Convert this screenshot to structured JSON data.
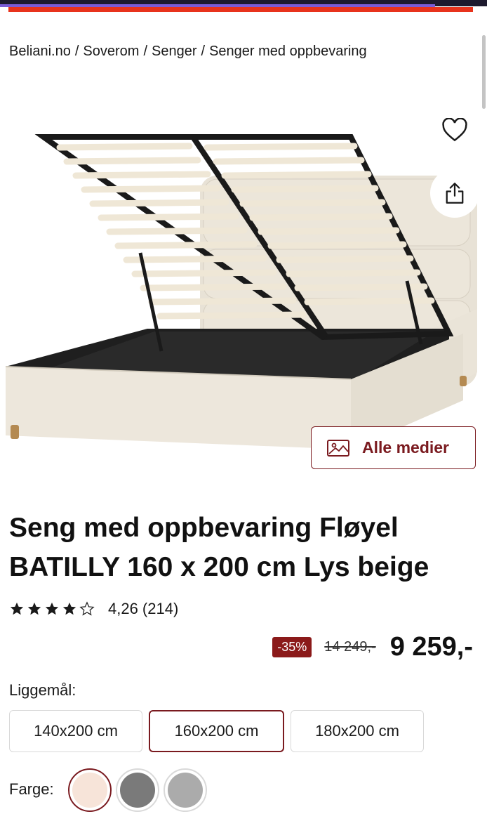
{
  "breadcrumb": {
    "items": [
      "Beliani.no",
      "Soverom",
      "Senger",
      "Senger med oppbevaring"
    ],
    "separator": "/"
  },
  "hero": {
    "favorite_icon": "heart-icon",
    "share_icon": "share-icon",
    "media_button_label": "Alle medier",
    "media_icon": "image-icon"
  },
  "product": {
    "title": "Seng med oppbevaring Fløyel BATILLY 160 x 200 cm Lys beige",
    "rating_value": 4.26,
    "rating_text": "4,26 (214)",
    "discount": "-35%",
    "old_price": "14 249,-",
    "price": "9 259,-"
  },
  "sizes": {
    "label": "Liggemål:",
    "options": [
      "140x200 cm",
      "160x200 cm",
      "180x200 cm"
    ],
    "selected": "160x200 cm"
  },
  "colors": {
    "label": "Farge:",
    "swatches": [
      "#f7e4d9",
      "#7a7a7a",
      "#ababab"
    ],
    "selected_index": 0
  },
  "theme": {
    "accent": "#7a1a1f",
    "top_stripe": "#e8331c"
  }
}
